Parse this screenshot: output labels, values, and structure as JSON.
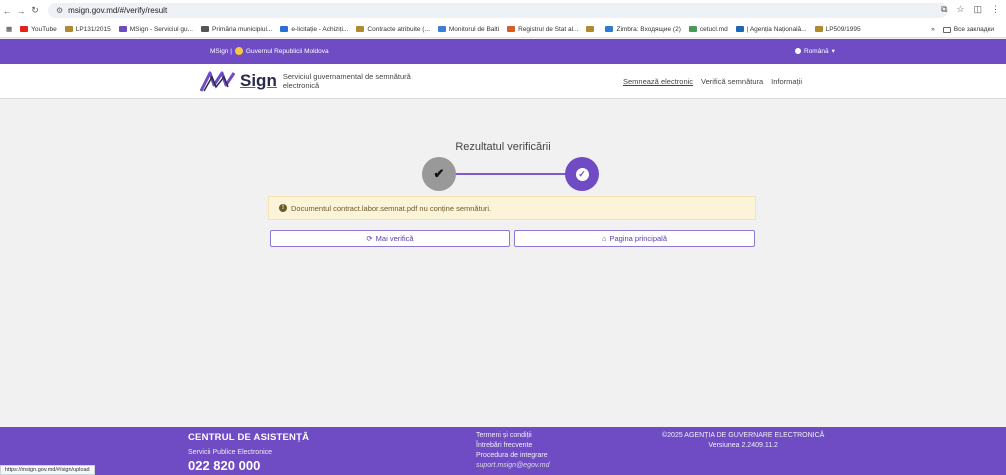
{
  "browser": {
    "url": "msign.gov.md/#/verify/result",
    "bookmarks": [
      {
        "label": "YouTube",
        "color": "#e62117"
      },
      {
        "label": "LP131/2015",
        "color": "#b08a2e"
      },
      {
        "label": "MSign - Serviciul gu...",
        "color": "#6f4bc4"
      },
      {
        "label": "Primăria municipiul...",
        "color": "#555555"
      },
      {
        "label": "e-licitație - Achiziți...",
        "color": "#2a6fd6"
      },
      {
        "label": "Contracte atribuite (...",
        "color": "#b08a2e"
      },
      {
        "label": "Monitorul de Balti",
        "color": "#3a7fd8"
      },
      {
        "label": "Registrul de Stat al...",
        "color": "#d95a2b"
      },
      {
        "label": "",
        "color": "#b08a2e"
      },
      {
        "label": "Zimbra: Входящие (2)",
        "color": "#2e7bd4"
      },
      {
        "label": "cetucl.md",
        "color": "#4a9a5a"
      },
      {
        "label": "| Agenția Națională...",
        "color": "#1d67b8"
      },
      {
        "label": "LP509/1995",
        "color": "#b08a2e"
      }
    ],
    "bookmarks_more": "»",
    "all_bookmarks": "Все закладки",
    "status_url": "https://msign.gov.md/#/sign/upload"
  },
  "gov_bar": {
    "left_text": "MSign |",
    "gov_text": "Guvernul Republicii Moldova",
    "language": "Română"
  },
  "header": {
    "logo_text": "Sign",
    "service_name": "Serviciul guvernamental de semnătură electronică",
    "nav": [
      "Semnează electronic",
      "Verifică semnătura",
      "Informații"
    ]
  },
  "main": {
    "title": "Rezultatul verificării",
    "alert": "Documentul contract.labor.semnat.pdf nu conține semnături.",
    "btn_verify": "Mai verifică",
    "btn_home": "Pagina principală"
  },
  "footer": {
    "title": "CENTRUL DE ASISTENȚĂ",
    "subtitle": "Servicii Publice Electronice",
    "phone": "022 820 000",
    "links": [
      "Termeni și condiții",
      "Întrebări frecvente",
      "Procedura de integrare"
    ],
    "email": "suport.msign@egov.md",
    "copyright": "©2025 AGENȚIA DE GUVERNARE ELECTRONICĂ",
    "version": "Versiunea 2.2409.11.2"
  },
  "colors": {
    "brand": "#6f4bc4",
    "alert_bg": "#fcf4d9"
  }
}
